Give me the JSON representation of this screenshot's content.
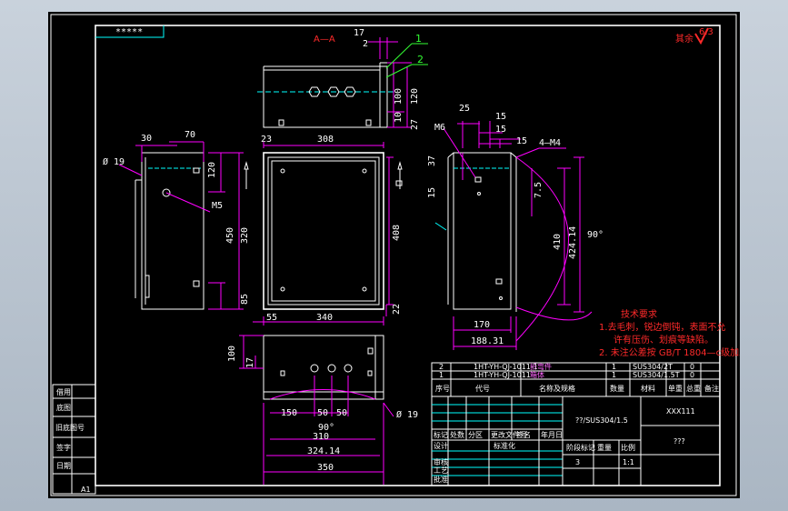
{
  "drawing": {
    "corner_tag": "*****",
    "section_label": "A—A",
    "roughness_note": "其余",
    "roughness_symbol": "6.3",
    "part_callouts": [
      "1",
      "2"
    ],
    "dims": {
      "d17": "17",
      "d2": "2",
      "d100": "100",
      "d120a": "120",
      "d10": "10",
      "d27": "27",
      "d30": "30",
      "d70": "70",
      "d120b": "120",
      "phi19a": "Ø 19",
      "m5": "M5",
      "d450": "450",
      "d320": "320",
      "d85": "85",
      "d23": "23",
      "d308": "308",
      "d408": "408",
      "d55": "55",
      "d340": "340",
      "d22": "22",
      "d25": "25",
      "d15a": "15",
      "d15b": "15",
      "d15c": "15",
      "m6": "M6",
      "m4": "4—M4",
      "d37": "37",
      "d15d": "15",
      "d7_5": "7.5",
      "d410": "410",
      "d424_14": "424.14",
      "deg90a": "90°",
      "d170": "170",
      "d188_31": "188.31",
      "d100b": "100",
      "d17b": "17",
      "d150": "150",
      "d50a": "50",
      "d50b": "50",
      "deg90b": "90°",
      "d310": "310",
      "d324_14": "324.14",
      "d350": "350",
      "phi19b": "Ø 19"
    },
    "tech_req": {
      "title": "技术要求",
      "line1": "1.去毛刺，锐边倒钝，表面不允",
      "line2": "许有压伤、划痕等缺陷。",
      "line3": "2. 未注公差按 GB/T 1804—c级加工。"
    }
  },
  "bom": {
    "rows": [
      {
        "no": "2",
        "code": "1HT-YH-QJ-1011-1",
        "name": "折弯件",
        "qty": "1",
        "material": "SUS304/2T",
        "weight": "0"
      },
      {
        "no": "1",
        "code": "1HT-YH-QJ-1011",
        "name": "箱体",
        "qty": "1",
        "material": "SUS304/1.5T",
        "weight": "0"
      }
    ],
    "header": [
      "序号",
      "代号",
      "名称及规格",
      "数量",
      "材料",
      "单重",
      "总重",
      "备注"
    ]
  },
  "title_block": {
    "material": "??/SUS304/1.5",
    "drawing_no": "XXX111",
    "name": "???",
    "col_labels": [
      "标记",
      "处数",
      "分区",
      "更改文件号",
      "签名",
      "年月日"
    ],
    "row_labels": [
      "设计",
      "审核",
      "工艺",
      "批准"
    ],
    "standard": "标准化",
    "stage": "阶段标记",
    "weight": "重量",
    "scale": "比例",
    "sheet": "3",
    "scale_val": "1:1"
  },
  "left_strip": [
    "借用",
    "底图",
    "旧底图号",
    "签字",
    "日期"
  ],
  "sheet_size": "A1"
}
